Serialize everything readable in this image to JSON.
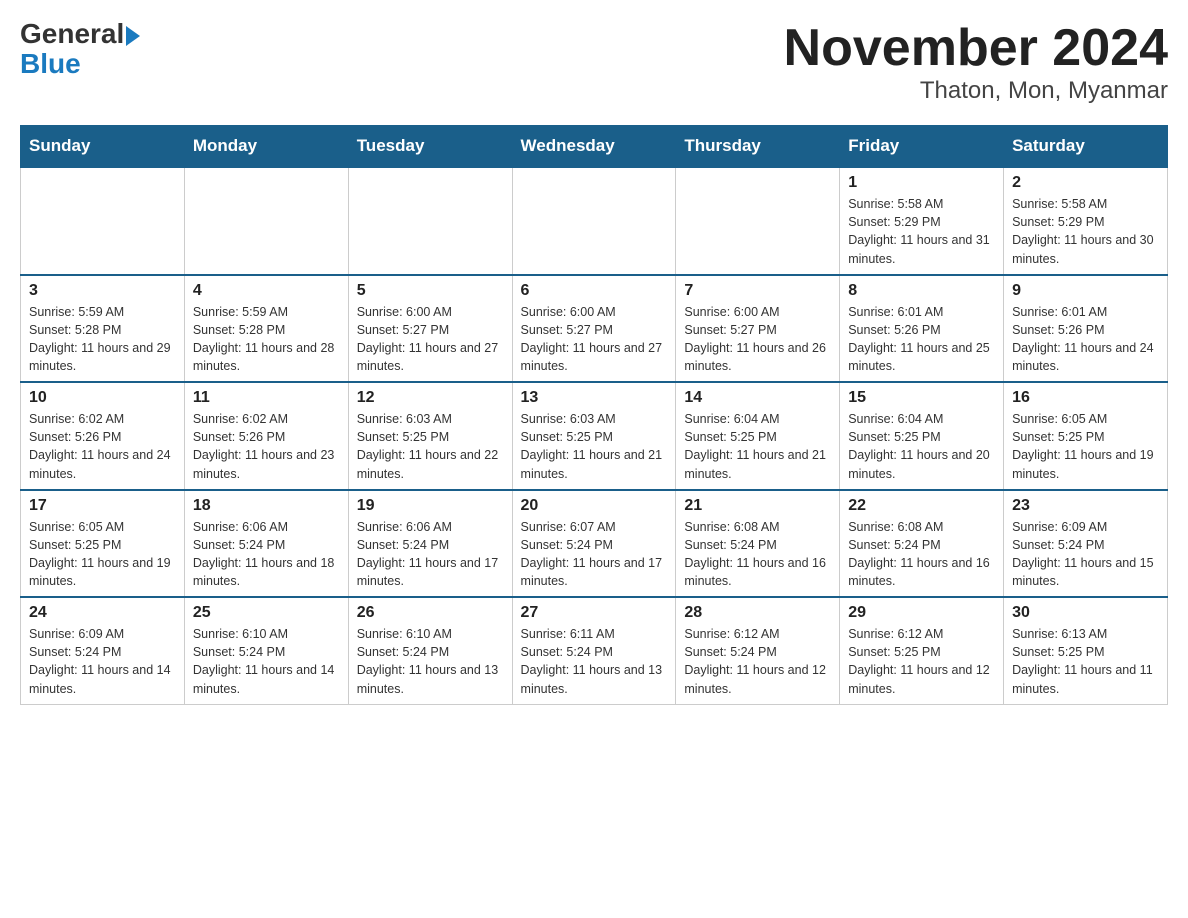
{
  "header": {
    "logo_general": "General",
    "logo_blue": "Blue",
    "title": "November 2024",
    "subtitle": "Thaton, Mon, Myanmar"
  },
  "days_of_week": [
    "Sunday",
    "Monday",
    "Tuesday",
    "Wednesday",
    "Thursday",
    "Friday",
    "Saturday"
  ],
  "weeks": [
    [
      {
        "day": "",
        "info": ""
      },
      {
        "day": "",
        "info": ""
      },
      {
        "day": "",
        "info": ""
      },
      {
        "day": "",
        "info": ""
      },
      {
        "day": "",
        "info": ""
      },
      {
        "day": "1",
        "info": "Sunrise: 5:58 AM\nSunset: 5:29 PM\nDaylight: 11 hours and 31 minutes."
      },
      {
        "day": "2",
        "info": "Sunrise: 5:58 AM\nSunset: 5:29 PM\nDaylight: 11 hours and 30 minutes."
      }
    ],
    [
      {
        "day": "3",
        "info": "Sunrise: 5:59 AM\nSunset: 5:28 PM\nDaylight: 11 hours and 29 minutes."
      },
      {
        "day": "4",
        "info": "Sunrise: 5:59 AM\nSunset: 5:28 PM\nDaylight: 11 hours and 28 minutes."
      },
      {
        "day": "5",
        "info": "Sunrise: 6:00 AM\nSunset: 5:27 PM\nDaylight: 11 hours and 27 minutes."
      },
      {
        "day": "6",
        "info": "Sunrise: 6:00 AM\nSunset: 5:27 PM\nDaylight: 11 hours and 27 minutes."
      },
      {
        "day": "7",
        "info": "Sunrise: 6:00 AM\nSunset: 5:27 PM\nDaylight: 11 hours and 26 minutes."
      },
      {
        "day": "8",
        "info": "Sunrise: 6:01 AM\nSunset: 5:26 PM\nDaylight: 11 hours and 25 minutes."
      },
      {
        "day": "9",
        "info": "Sunrise: 6:01 AM\nSunset: 5:26 PM\nDaylight: 11 hours and 24 minutes."
      }
    ],
    [
      {
        "day": "10",
        "info": "Sunrise: 6:02 AM\nSunset: 5:26 PM\nDaylight: 11 hours and 24 minutes."
      },
      {
        "day": "11",
        "info": "Sunrise: 6:02 AM\nSunset: 5:26 PM\nDaylight: 11 hours and 23 minutes."
      },
      {
        "day": "12",
        "info": "Sunrise: 6:03 AM\nSunset: 5:25 PM\nDaylight: 11 hours and 22 minutes."
      },
      {
        "day": "13",
        "info": "Sunrise: 6:03 AM\nSunset: 5:25 PM\nDaylight: 11 hours and 21 minutes."
      },
      {
        "day": "14",
        "info": "Sunrise: 6:04 AM\nSunset: 5:25 PM\nDaylight: 11 hours and 21 minutes."
      },
      {
        "day": "15",
        "info": "Sunrise: 6:04 AM\nSunset: 5:25 PM\nDaylight: 11 hours and 20 minutes."
      },
      {
        "day": "16",
        "info": "Sunrise: 6:05 AM\nSunset: 5:25 PM\nDaylight: 11 hours and 19 minutes."
      }
    ],
    [
      {
        "day": "17",
        "info": "Sunrise: 6:05 AM\nSunset: 5:25 PM\nDaylight: 11 hours and 19 minutes."
      },
      {
        "day": "18",
        "info": "Sunrise: 6:06 AM\nSunset: 5:24 PM\nDaylight: 11 hours and 18 minutes."
      },
      {
        "day": "19",
        "info": "Sunrise: 6:06 AM\nSunset: 5:24 PM\nDaylight: 11 hours and 17 minutes."
      },
      {
        "day": "20",
        "info": "Sunrise: 6:07 AM\nSunset: 5:24 PM\nDaylight: 11 hours and 17 minutes."
      },
      {
        "day": "21",
        "info": "Sunrise: 6:08 AM\nSunset: 5:24 PM\nDaylight: 11 hours and 16 minutes."
      },
      {
        "day": "22",
        "info": "Sunrise: 6:08 AM\nSunset: 5:24 PM\nDaylight: 11 hours and 16 minutes."
      },
      {
        "day": "23",
        "info": "Sunrise: 6:09 AM\nSunset: 5:24 PM\nDaylight: 11 hours and 15 minutes."
      }
    ],
    [
      {
        "day": "24",
        "info": "Sunrise: 6:09 AM\nSunset: 5:24 PM\nDaylight: 11 hours and 14 minutes."
      },
      {
        "day": "25",
        "info": "Sunrise: 6:10 AM\nSunset: 5:24 PM\nDaylight: 11 hours and 14 minutes."
      },
      {
        "day": "26",
        "info": "Sunrise: 6:10 AM\nSunset: 5:24 PM\nDaylight: 11 hours and 13 minutes."
      },
      {
        "day": "27",
        "info": "Sunrise: 6:11 AM\nSunset: 5:24 PM\nDaylight: 11 hours and 13 minutes."
      },
      {
        "day": "28",
        "info": "Sunrise: 6:12 AM\nSunset: 5:24 PM\nDaylight: 11 hours and 12 minutes."
      },
      {
        "day": "29",
        "info": "Sunrise: 6:12 AM\nSunset: 5:25 PM\nDaylight: 11 hours and 12 minutes."
      },
      {
        "day": "30",
        "info": "Sunrise: 6:13 AM\nSunset: 5:25 PM\nDaylight: 11 hours and 11 minutes."
      }
    ]
  ]
}
